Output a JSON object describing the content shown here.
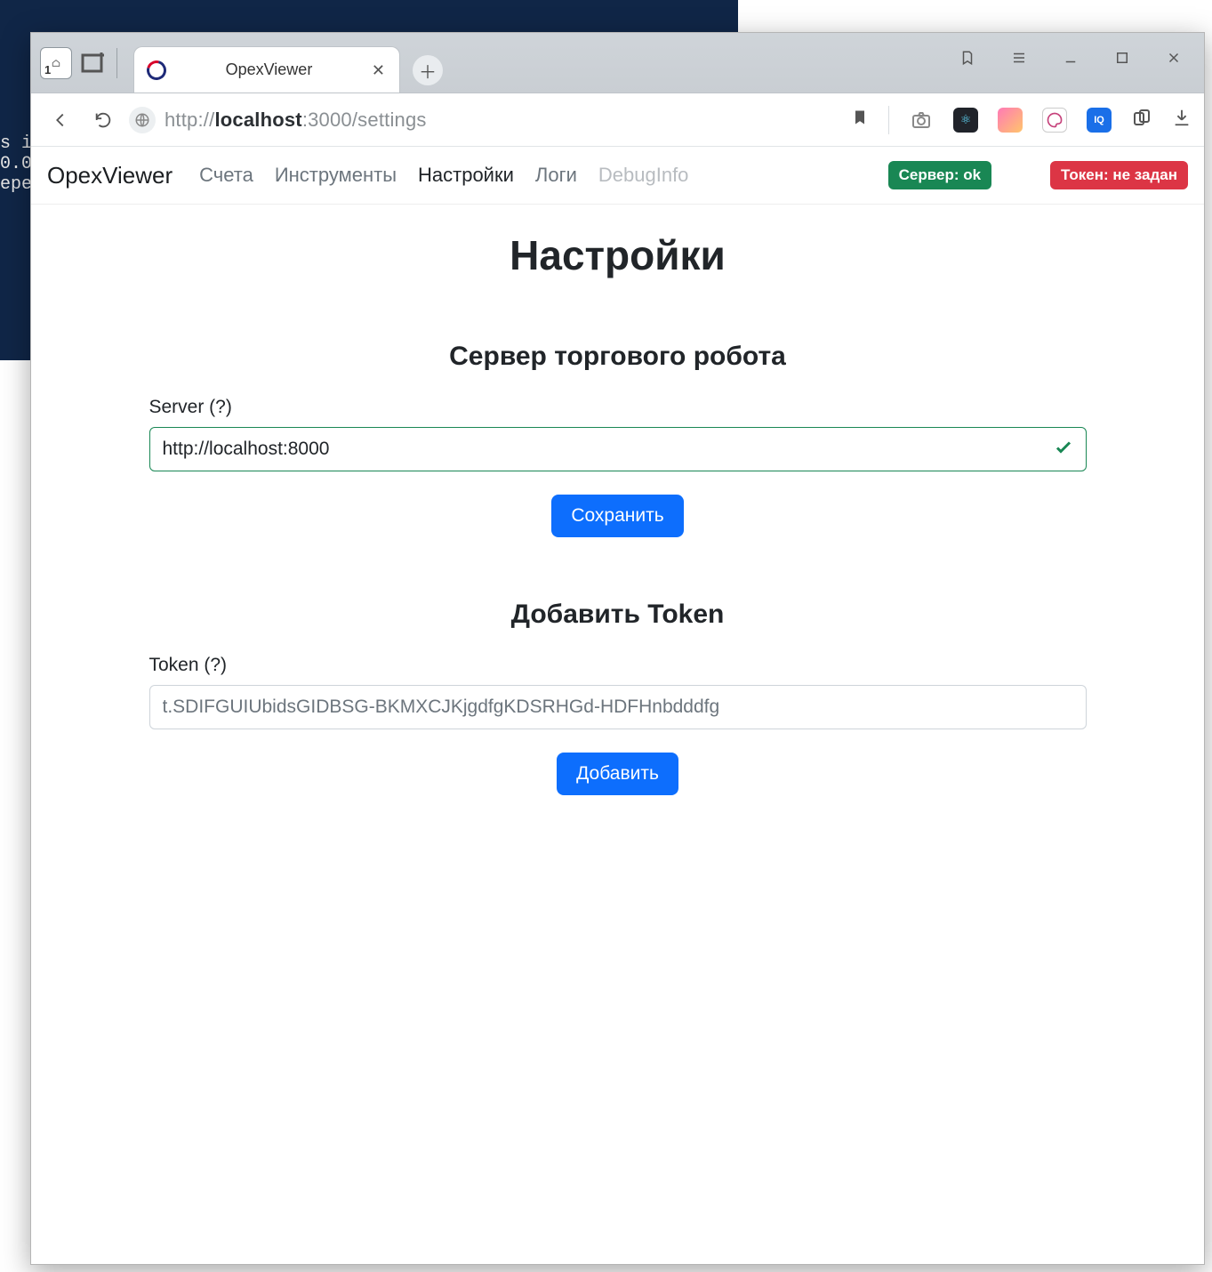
{
  "background_terminal": {
    "lines": [
      "s i",
      "",
      "0.0",
      "ере"
    ]
  },
  "browser": {
    "workspace_badge": "1",
    "tab": {
      "title": "OpexViewer"
    },
    "url_prefix": "http://",
    "url_host": "localhost",
    "url_suffix": ":3000/settings"
  },
  "app": {
    "brand": "OpexViewer",
    "nav": {
      "accounts": "Счета",
      "instruments": "Инструменты",
      "settings": "Настройки",
      "logs": "Логи",
      "debug": "DebugInfo"
    },
    "status": {
      "server": "Сервер: ok",
      "token": "Токен: не задан"
    },
    "page_title": "Настройки",
    "server_section": {
      "title": "Сервер торгового робота",
      "label": "Server (?)",
      "value": "http://localhost:8000",
      "save": "Сохранить"
    },
    "token_section": {
      "title": "Добавить Token",
      "label": "Token (?)",
      "placeholder": "t.SDIFGUIUbidsGIDBSG-BKMXCJKjgdfgKDSRHGd-HDFHnbdddfg",
      "add": "Добавить"
    }
  }
}
